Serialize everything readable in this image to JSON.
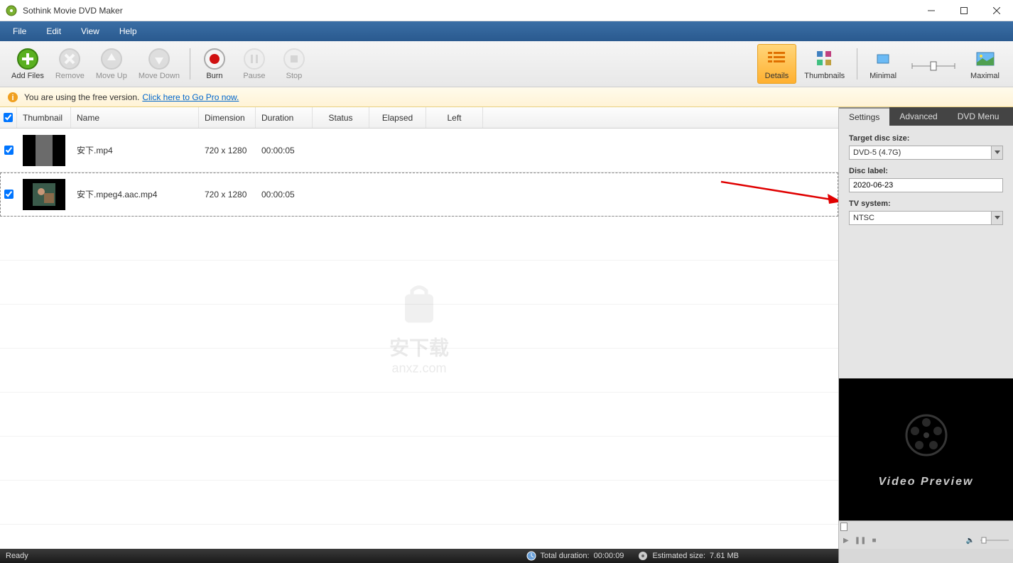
{
  "window": {
    "title": "Sothink Movie DVD Maker"
  },
  "menu": {
    "file": "File",
    "edit": "Edit",
    "view": "View",
    "help": "Help"
  },
  "toolbar": {
    "add_files": "Add Files",
    "remove": "Remove",
    "move_up": "Move Up",
    "move_down": "Move Down",
    "burn": "Burn",
    "pause": "Pause",
    "stop": "Stop"
  },
  "view_modes": {
    "details": "Details",
    "thumbnails": "Thumbnails",
    "minimal": "Minimal",
    "maximal": "Maximal"
  },
  "infobar": {
    "text": "You are using the free version.",
    "link": "Click here to Go Pro now."
  },
  "table": {
    "headers": {
      "thumbnail": "Thumbnail",
      "name": "Name",
      "dimension": "Dimension",
      "duration": "Duration",
      "status": "Status",
      "elapsed": "Elapsed",
      "left": "Left"
    },
    "rows": [
      {
        "name": "安下.mp4",
        "dimension": "720 x 1280",
        "duration": "00:00:05",
        "checked": true,
        "selected": false
      },
      {
        "name": "安下.mpeg4.aac.mp4",
        "dimension": "720 x 1280",
        "duration": "00:00:05",
        "checked": true,
        "selected": true
      }
    ]
  },
  "watermark": {
    "line1": "安下载",
    "line2": "anxz.com"
  },
  "tabs": {
    "settings": "Settings",
    "advanced": "Advanced",
    "dvd_menu": "DVD Menu"
  },
  "settings": {
    "target_disc_size_label": "Target disc size:",
    "target_disc_size_value": "DVD-5 (4.7G)",
    "disc_label_label": "Disc label:",
    "disc_label_value": "2020-06-23",
    "tv_system_label": "TV system:",
    "tv_system_value": "NTSC"
  },
  "preview": {
    "text": "Video Preview"
  },
  "statusbar": {
    "ready": "Ready",
    "total_duration_label": "Total duration:",
    "total_duration_value": "00:00:09",
    "estimated_size_label": "Estimated size:",
    "estimated_size_value": "7.61 MB"
  }
}
